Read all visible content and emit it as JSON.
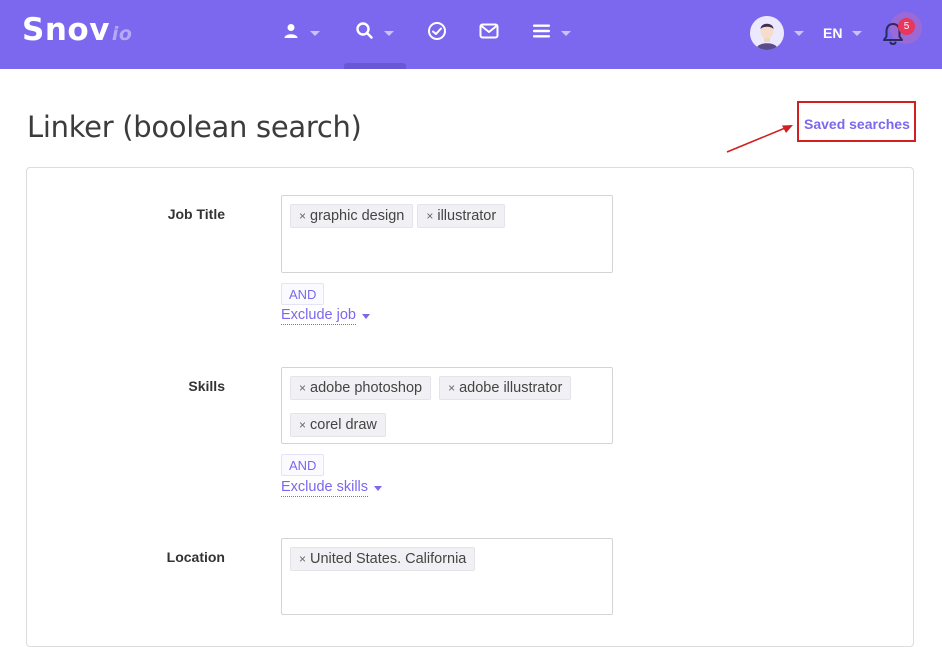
{
  "brand": {
    "name": "Snov",
    "suffix": "io"
  },
  "nav": {
    "language": "EN",
    "notifications_count": "5"
  },
  "header": {
    "title": "Linker (boolean search)",
    "saved_searches": "Saved searches"
  },
  "form": {
    "job_title": {
      "label": "Job Title",
      "tags": [
        "graphic design",
        "illustrator"
      ],
      "and_label": "AND",
      "exclude_label": "Exclude job"
    },
    "skills": {
      "label": "Skills",
      "tags": [
        "adobe photoshop",
        "adobe illustrator",
        "corel draw"
      ],
      "and_label": "AND",
      "exclude_label": "Exclude skills"
    },
    "location": {
      "label": "Location",
      "tags": [
        "United States. California"
      ]
    }
  },
  "colors": {
    "brand": "#7b68ee",
    "badge": "#e8365d",
    "annotation": "#d02020"
  }
}
